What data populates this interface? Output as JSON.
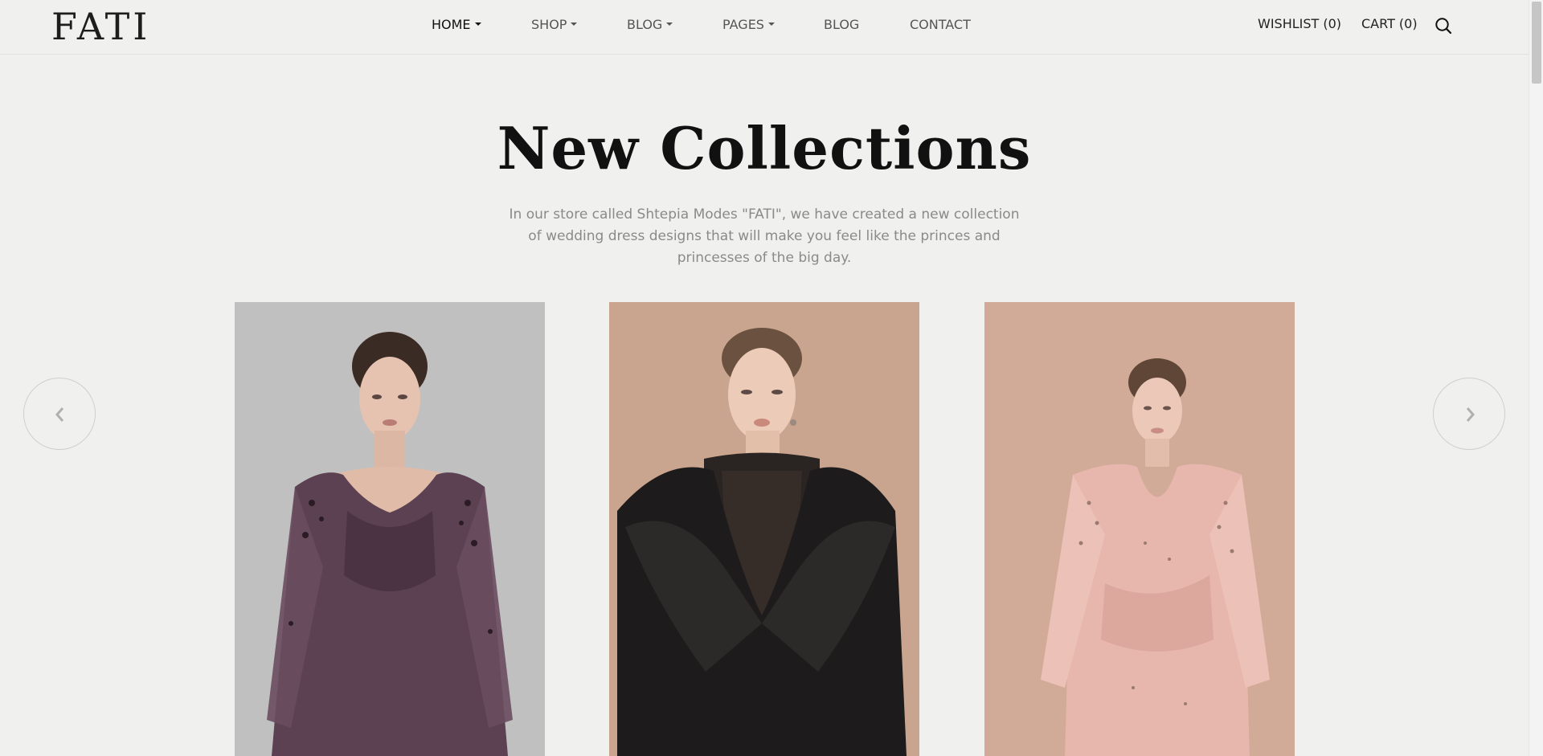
{
  "brand": {
    "logo": "FATI"
  },
  "nav": {
    "items": [
      {
        "label": "HOME",
        "dropdown": true,
        "active": true
      },
      {
        "label": "SHOP",
        "dropdown": true,
        "active": false
      },
      {
        "label": "BLOG",
        "dropdown": true,
        "active": false
      },
      {
        "label": "PAGES",
        "dropdown": true,
        "active": false
      },
      {
        "label": "BLOG",
        "dropdown": false,
        "active": false
      },
      {
        "label": "CONTACT",
        "dropdown": false,
        "active": false
      }
    ]
  },
  "header_actions": {
    "wishlist": "WISHLIST (0)",
    "cart": "CART (0)",
    "search_icon": "search-icon"
  },
  "hero": {
    "title": "New Collections",
    "description": "In our store called Shtepia Modes \"FATI\", we have created a new collection of wedding dress designs that will make you feel like the princes and princesses of the big day."
  },
  "carousel": {
    "prev_icon": "chevron-left-icon",
    "next_icon": "chevron-right-icon",
    "products": [
      {
        "dress_color": "#5b4152",
        "background": "#b9b8b8"
      },
      {
        "dress_color": "#1d1b1b",
        "background": "#c9a48e"
      },
      {
        "dress_color": "#e7b6ac",
        "background": "#d1ab98"
      }
    ]
  },
  "colors": {
    "page_bg": "#f0f0ef",
    "text": "#111111",
    "muted": "#8a8a8a"
  }
}
